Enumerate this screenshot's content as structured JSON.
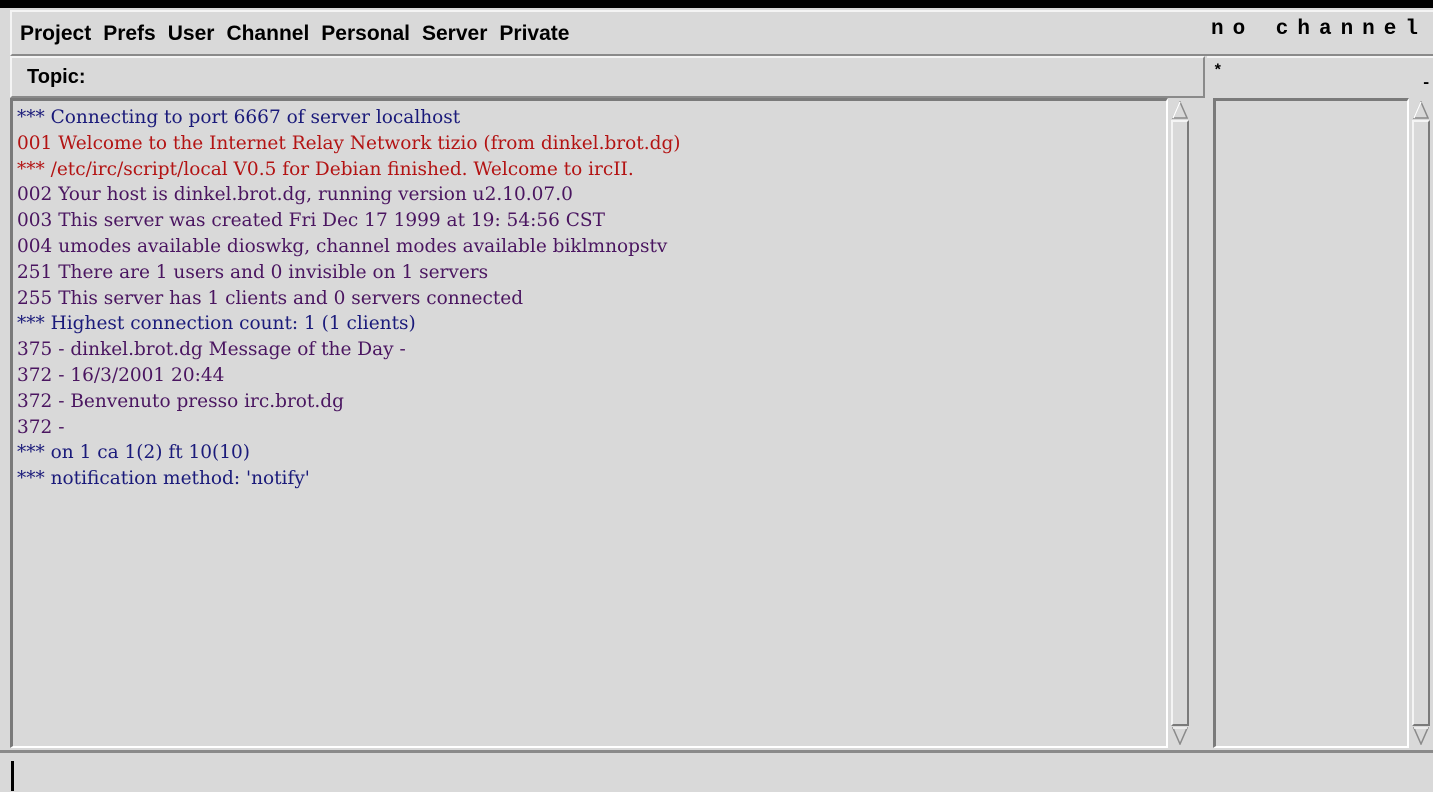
{
  "menu": {
    "items": [
      "Project",
      "Prefs",
      "User",
      "Channel",
      "Personal",
      "Server",
      "Private"
    ],
    "channel_status": "no channel"
  },
  "topic": {
    "label": "Topic:",
    "value": ""
  },
  "nicklist": {
    "header_mark": "*",
    "header_dash": "-"
  },
  "output": {
    "lines": [
      {
        "text": "*** Connecting to port 6667 of server localhost",
        "color": "blue"
      },
      {
        "text": "001 Welcome to the Internet Relay Network tizio (from dinkel.brot.dg)",
        "color": "red"
      },
      {
        "text": "*** /etc/irc/script/local V0.5 for Debian finished. Welcome to ircII.",
        "color": "red"
      },
      {
        "text": "002 Your host is dinkel.brot.dg, running version u2.10.07.0",
        "color": "purple"
      },
      {
        "text": "003 This server was created Fri Dec 17 1999 at 19: 54:56 CST",
        "color": "purple"
      },
      {
        "text": "004 umodes available dioswkg, channel modes available biklmnopstv",
        "color": "purple"
      },
      {
        "text": "251 There are 1 users and 0 invisible on 1 servers",
        "color": "purple"
      },
      {
        "text": "255 This server has 1 clients and 0 servers connected",
        "color": "purple"
      },
      {
        "text": "*** Highest connection count: 1 (1 clients)",
        "color": "blue"
      },
      {
        "text": "375 - dinkel.brot.dg Message of the Day -",
        "color": "purple"
      },
      {
        "text": "372 - 16/3/2001 20:44",
        "color": "purple"
      },
      {
        "text": "372 - Benvenuto presso irc.brot.dg",
        "color": "purple"
      },
      {
        "text": "372 -",
        "color": "purple"
      },
      {
        "text": "*** on 1 ca 1(2) ft 10(10)",
        "color": "blue"
      },
      {
        "text": "*** notification method: 'notify'",
        "color": "blue"
      }
    ]
  },
  "input": {
    "value": ""
  },
  "colors": {
    "blue": "#1a1a7a",
    "red": "#b31313",
    "purple": "#4a1560",
    "background": "#d9d9d9"
  }
}
